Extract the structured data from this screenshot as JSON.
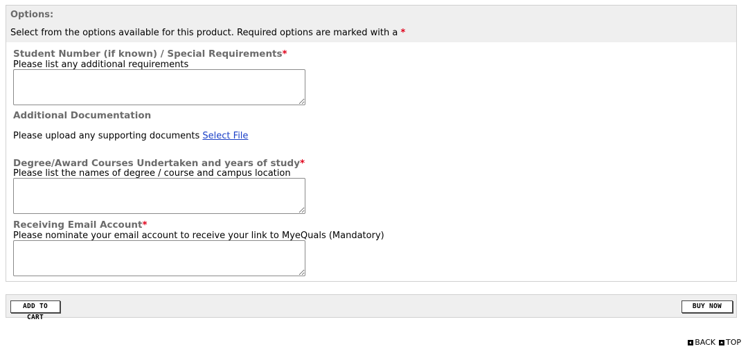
{
  "options": {
    "title": "Options:",
    "description": "Select from the options available for this product. Required options are marked with a",
    "required_marker": "*"
  },
  "fields": [
    {
      "label": "Student Number (if known) / Special Requirements",
      "required": "*",
      "hint": "Please list any additional requirements",
      "value": ""
    },
    {
      "label": "Degree/Award Courses Undertaken and years of study",
      "required": "*",
      "hint": "Please list the names of degree / course and campus location",
      "value": ""
    },
    {
      "label": "Receiving Email Account",
      "required": "*",
      "hint": "Please nominate your email account to receive your link to MyeQuals (Mandatory)",
      "value": ""
    }
  ],
  "documentation": {
    "label": "Additional Documentation",
    "prompt": "Please upload any supporting documents",
    "link_text": "Select File"
  },
  "actions": {
    "add_to_cart": "ADD TO CART",
    "buy_now": "BUY NOW"
  },
  "footer": {
    "back": "BACK",
    "top": "TOP"
  },
  "colors": {
    "required": "#e0001a",
    "label": "#6b6b6b",
    "panel_bg": "#efefef",
    "link": "#1a3fc7"
  },
  "icons": [
    "back-arrow-icon",
    "top-arrow-icon"
  ]
}
